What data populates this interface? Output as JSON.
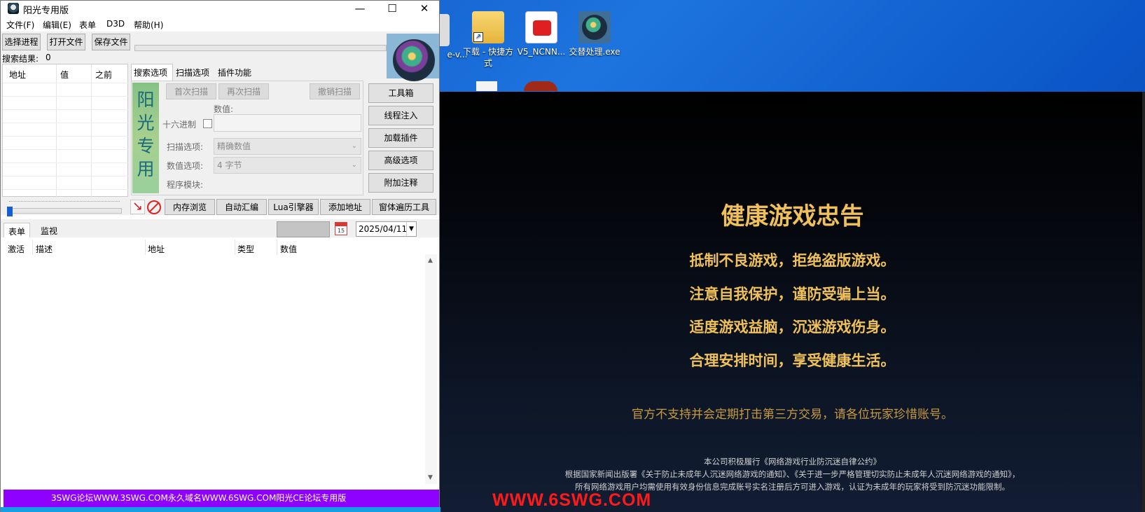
{
  "window": {
    "title": "阳光专用版",
    "menu": [
      "文件(F)",
      "编辑(E)",
      "表单",
      "D3D",
      "帮助(H)"
    ]
  },
  "toolbar": {
    "select_process": "选择进程",
    "open_file": "打开文件",
    "save_file": "保存文件"
  },
  "search_results": {
    "label": "搜索结果:",
    "count": "0"
  },
  "address_list": {
    "columns": [
      "地址",
      "值",
      "之前"
    ]
  },
  "upper_tabs": [
    "搜索选项",
    "扫描选项",
    "插件功能"
  ],
  "banner_text": [
    "阳",
    "光",
    "专",
    "用"
  ],
  "scan": {
    "first_scan": "首次扫描",
    "next_scan": "再次扫描",
    "undo_scan": "撤销扫描",
    "value_label": "数值:",
    "hex_label": "十六进制",
    "scan_option_label": "扫描选项:",
    "scan_option_value": "精确数值",
    "value_option_label": "数值选项:",
    "value_option_value": "4 字节",
    "module_label": "程序模块:"
  },
  "side_buttons": [
    "工具箱",
    "线程注入",
    "加载插件",
    "高级选项",
    "附加注释"
  ],
  "bottom_buttons": [
    "内存浏览",
    "自动汇编",
    "Lua引擎器",
    "添加地址",
    "窗体遍历工具"
  ],
  "lower_tabs": [
    "表单",
    "监视"
  ],
  "date": {
    "calendar_day": "15",
    "value": "2025/04/11"
  },
  "table_columns": [
    "激活",
    "描述",
    "地址",
    "类型",
    "数值"
  ],
  "status_bar": "3SWG论坛WWW.3SWG.COM永久域名WWW.6SWG.COM阳光CE论坛专用版",
  "desktop_icons": [
    {
      "label": "e-v...",
      "icon": "partial-icon"
    },
    {
      "label": "下载 - 快捷方式",
      "icon": "download-folder-shortcut-icon"
    },
    {
      "label": "V5_NCNN...",
      "icon": "red-app-icon"
    },
    {
      "label": "交替处理.exe",
      "icon": "exe-icon"
    }
  ],
  "game": {
    "title": "健康游戏忠告",
    "lines": [
      "抵制不良游戏，拒绝盗版游戏。",
      "注意自我保护，谨防受骗上当。",
      "适度游戏益脑，沉迷游戏伤身。",
      "合理安排时间，享受健康生活。"
    ],
    "notice": "官方不支持并会定期打击第三方交易，请各位玩家珍惜账号。",
    "footer": [
      "本公司积极履行《网络游戏行业防沉迷自律公约》",
      "根据国家新闻出版署《关于防止未成年人沉迷网络游戏的通知》、《关于进一步严格管理切实防止未成年人沉迷网络游戏的通知》，",
      "所有网络游戏用户均需使用有效身份信息完成账号实名注册后方可进入游戏，认证为未成年的玩家将受到防沉迷功能限制。"
    ],
    "watermark": "WWW.6SWG.COM"
  },
  "colors": {
    "status_bar": "#8e00ff",
    "game_gold": "#f0c15a",
    "watermark_red": "#ff1a1a"
  }
}
